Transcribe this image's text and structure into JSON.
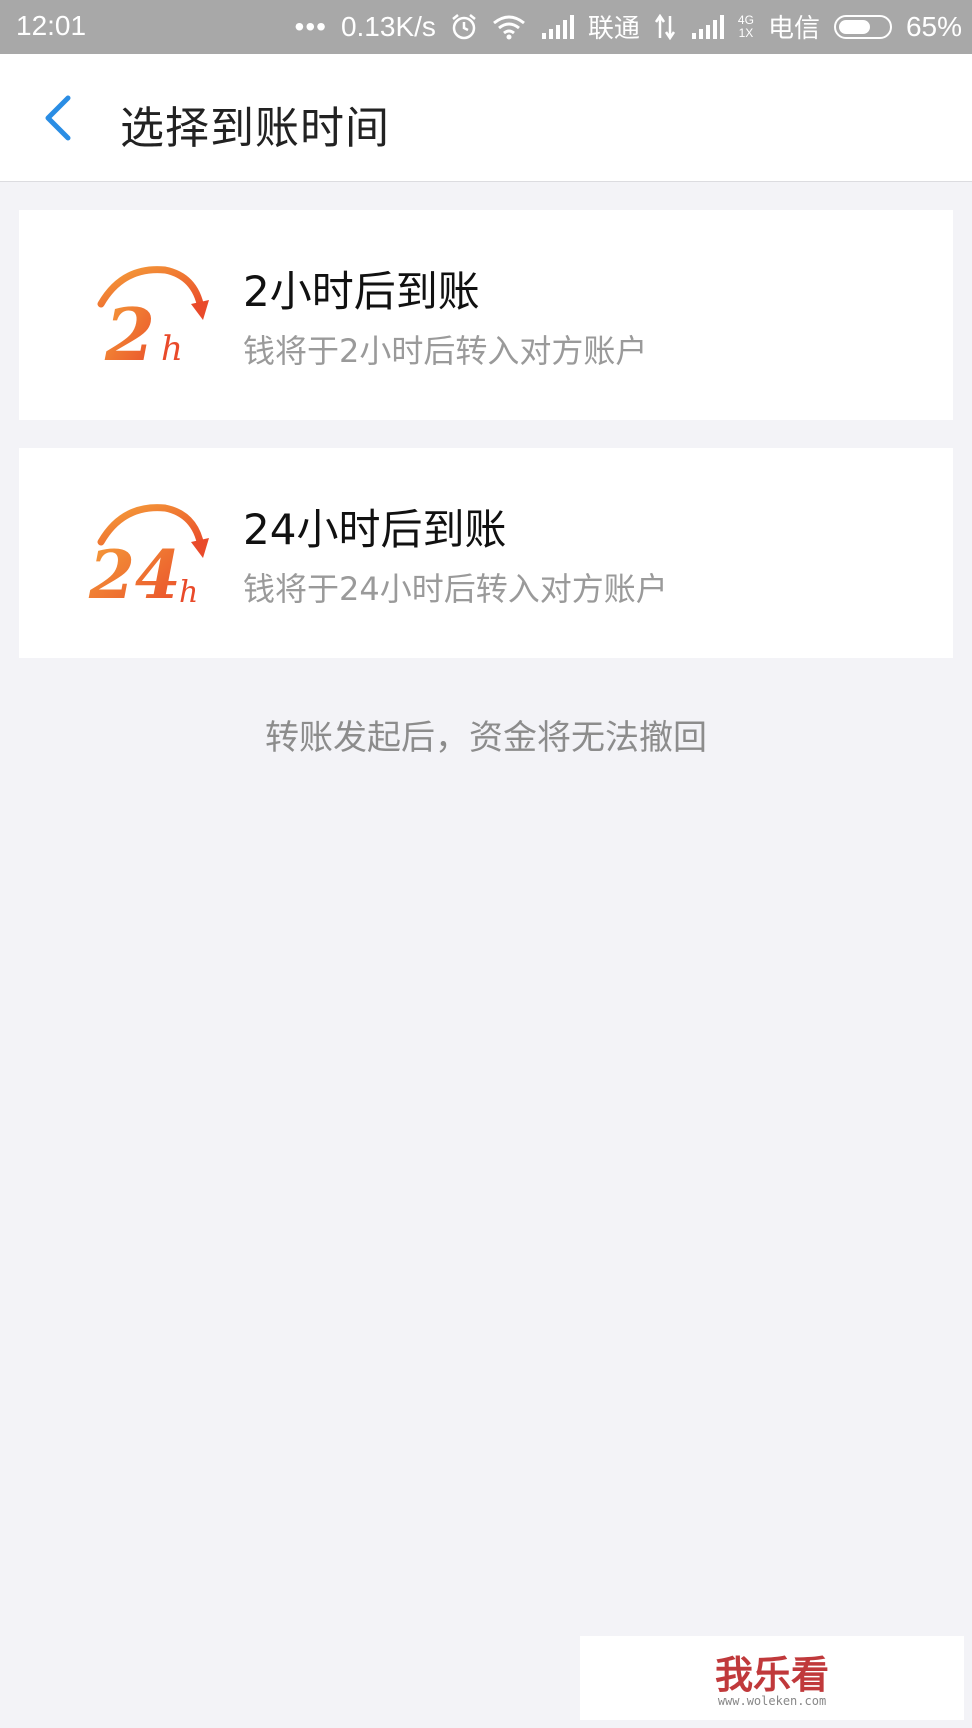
{
  "status_bar": {
    "time": "12:01",
    "dots": "•••",
    "network_speed": "0.13K/s",
    "carrier1": "联通",
    "net_type_top": "4G",
    "net_type_bottom": "1X",
    "carrier2": "电信",
    "battery": "65%",
    "battery_level": 0.65,
    "icons": [
      "alarm-icon",
      "wifi-icon",
      "signal-icon",
      "data-arrows-icon",
      "signal-icon",
      "battery-icon"
    ]
  },
  "header": {
    "title": "选择到账时间",
    "back_icon": "chevron-left-icon",
    "accent": "#2a8de4"
  },
  "options": [
    {
      "icon_text": "2",
      "icon_unit": "h",
      "title": "2小时后到账",
      "subtitle": "钱将于2小时后转入对方账户"
    },
    {
      "icon_text": "24",
      "icon_unit": "h",
      "title": "24小时后到账",
      "subtitle": "钱将于24小时后转入对方账户"
    }
  ],
  "note": "转账发起后，资金将无法撤回",
  "watermark": {
    "text": "我乐看",
    "url": "www.woleken.com"
  },
  "colors": {
    "icon_orange": "#f07a2c",
    "icon_red": "#e94a2a",
    "background": "#f3f3f7"
  }
}
